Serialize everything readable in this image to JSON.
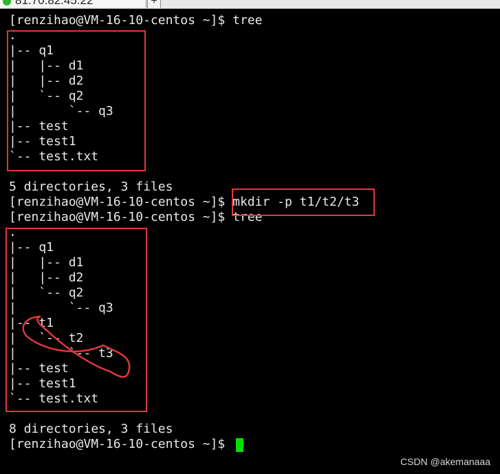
{
  "tab": {
    "title": "81.70.82.45:22",
    "new_tab_label": "+"
  },
  "terminal": {
    "lines": [
      "[renzihao@VM-16-10-centos ~]$ tree",
      ".",
      "|-- q1",
      "|   |-- d1",
      "|   |-- d2",
      "|   `-- q2",
      "|       `-- q3",
      "|-- test",
      "|-- test1",
      "`-- test.txt",
      "",
      "5 directories, 3 files",
      "[renzihao@VM-16-10-centos ~]$ mkdir -p t1/t2/t3",
      "[renzihao@VM-16-10-centos ~]$ tree",
      ".",
      "|-- q1",
      "|   |-- d1",
      "|   |-- d2",
      "|   `-- q2",
      "|       `-- q3",
      "|-- t1",
      "|   `-- t2",
      "|       `-- t3",
      "|-- test",
      "|-- test1",
      "`-- test.txt",
      "",
      "8 directories, 3 files",
      "[renzihao@VM-16-10-centos ~]$ "
    ]
  },
  "colors": {
    "background": "#000000",
    "text": "#e9e9e9",
    "highlight": "#e0393b",
    "cursor": "#00e000"
  },
  "watermark": "CSDN @akemanaaa"
}
